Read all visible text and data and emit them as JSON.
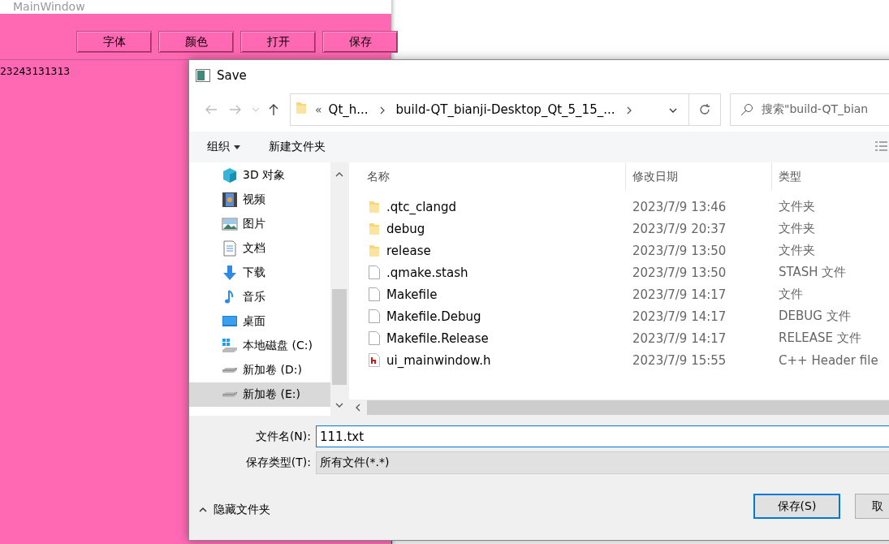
{
  "main_window": {
    "title": "MainWindow",
    "buttons": [
      "字体",
      "颜色",
      "打开",
      "保存"
    ],
    "text": "23243131313"
  },
  "dialog": {
    "title": "Save",
    "address": {
      "overflow_mark": "«",
      "breadcrumbs": [
        "Qt_h...",
        "build-QT_bianji-Desktop_Qt_5_15_..."
      ]
    },
    "search": {
      "placeholder": "搜索\"build-QT_bian"
    },
    "toolbar": {
      "organize": "组织",
      "new_folder": "新建文件夹"
    },
    "nav": [
      {
        "label": "3D 对象",
        "kind": "cube",
        "selected": false
      },
      {
        "label": "视频",
        "kind": "video",
        "selected": false
      },
      {
        "label": "图片",
        "kind": "image",
        "selected": false
      },
      {
        "label": "文档",
        "kind": "document",
        "selected": false
      },
      {
        "label": "下载",
        "kind": "download",
        "selected": false
      },
      {
        "label": "音乐",
        "kind": "music",
        "selected": false
      },
      {
        "label": "桌面",
        "kind": "desktop",
        "selected": false
      },
      {
        "label": "本地磁盘 (C:)",
        "kind": "system-drive",
        "selected": false
      },
      {
        "label": "新加卷 (D:)",
        "kind": "drive",
        "selected": false
      },
      {
        "label": "新加卷 (E:)",
        "kind": "drive",
        "selected": true
      }
    ],
    "columns": [
      "名称",
      "修改日期",
      "类型"
    ],
    "files": [
      {
        "name": ".qtc_clangd",
        "date": "2023/7/9 13:46",
        "type": "文件夹",
        "kind": "folder"
      },
      {
        "name": "debug",
        "date": "2023/7/9 20:37",
        "type": "文件夹",
        "kind": "folder"
      },
      {
        "name": "release",
        "date": "2023/7/9 13:50",
        "type": "文件夹",
        "kind": "folder"
      },
      {
        "name": ".qmake.stash",
        "date": "2023/7/9 13:50",
        "type": "STASH 文件",
        "kind": "file"
      },
      {
        "name": "Makefile",
        "date": "2023/7/9 14:17",
        "type": "文件",
        "kind": "file"
      },
      {
        "name": "Makefile.Debug",
        "date": "2023/7/9 14:17",
        "type": "DEBUG 文件",
        "kind": "file"
      },
      {
        "name": "Makefile.Release",
        "date": "2023/7/9 14:17",
        "type": "RELEASE 文件",
        "kind": "file"
      },
      {
        "name": "ui_mainwindow.h",
        "date": "2023/7/9 15:55",
        "type": "C++ Header file",
        "kind": "header"
      }
    ],
    "filename": {
      "label": "文件名(N):",
      "value": "111.txt"
    },
    "filetype": {
      "label": "保存类型(T):",
      "value": "所有文件(*.*)"
    },
    "hide_folders": "隐藏文件夹",
    "buttons": [
      {
        "label": "保存(S)",
        "default": true
      },
      {
        "label": "取",
        "default": false
      }
    ]
  }
}
